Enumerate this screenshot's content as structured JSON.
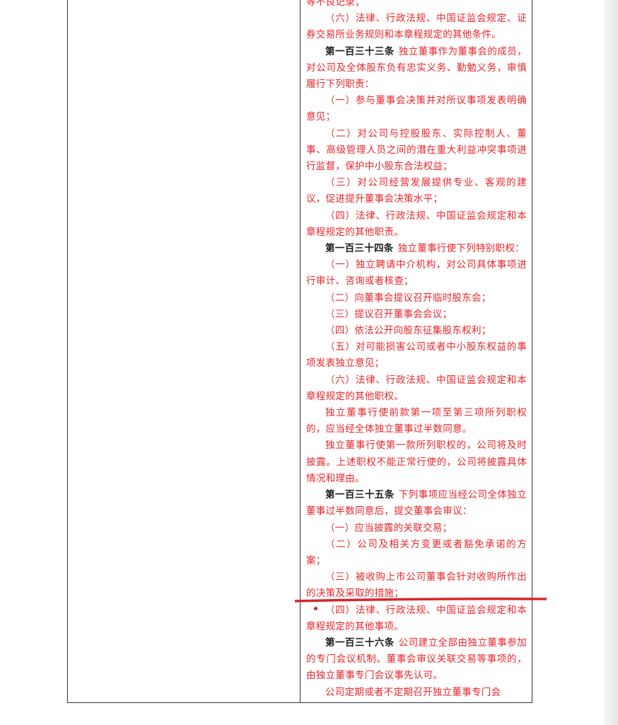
{
  "document": {
    "lines": {
      "l0": "等不良记录；",
      "p1": "（六）法律、行政法规、中国证监会规定、证券交易所业务规则和本章程规定的其他条件。",
      "a133_num": "第一百三十三条",
      "a133_text": "独立董事作为董事会的成员，对公司及全体股东负有忠实义务、勤勉义务，审慎履行下列职责：",
      "a133_1": "（一）参与董事会决策并对所议事项发表明确意见；",
      "a133_2": "（二）对公司与控股股东、实际控制人、董事、高级管理人员之间的潜在重大利益冲突事项进行监督，保护中小股东合法权益；",
      "a133_3": "（三）对公司经营发展提供专业、客观的建议，促进提升董事会决策水平；",
      "a133_4": "（四）法律、行政法规、中国证监会规定和本章程规定的其他职责。",
      "a134_num": "第一百三十四条",
      "a134_text": "独立董事行使下列特别职权：",
      "a134_1": "（一）独立聘请中介机构，对公司具体事项进行审计、咨询或者核查；",
      "a134_2": "（二）向董事会提议召开临时股东会；",
      "a134_3": "（三）提议召开董事会会议；",
      "a134_4": "（四）依法公开向股东征集股东权利；",
      "a134_5": "（五）对可能损害公司或者中小股东权益的事项发表独立意见；",
      "a134_6": "（六）法律、行政法规、中国证监会规定和本章程规定的其他职权。",
      "a134_p2": "独立董事行使前款第一项至第三项所列职权的，应当经全体独立董事过半数同意。",
      "a134_p3": "独立董事行使第一款所列职权的，公司将及时披露。上述职权不能正常行使的，公司将披露具体情况和理由。",
      "a135_num": "第一百三十五条",
      "a135_text": "下列事项应当经公司全体独立董事过半数同意后，提交董事会审议：",
      "a135_1": "（一）应当披露的关联交易；",
      "a135_2": "（二）公司及相关方变更或者豁免承诺的方案；",
      "a135_3": "（三）被收购上市公司董事会针对收购所作出的决策及采取的措施；",
      "a135_4": "（四）法律、行政法规、中国证监会规定和本章程规定的其他事项。",
      "a136_num": "第一百三十六条",
      "a136_text": "公司建立全部由独立董事参加的专门会议机制。董事会审议关联交易等事项的，由独立董事专门会议事先认可。",
      "a136_p2": "公司定期或者不定期召开独立董事专门会"
    }
  },
  "colors": {
    "text": "#e8262a",
    "article_number": "#1a1a1a",
    "annotation_line": "#d8242b"
  }
}
